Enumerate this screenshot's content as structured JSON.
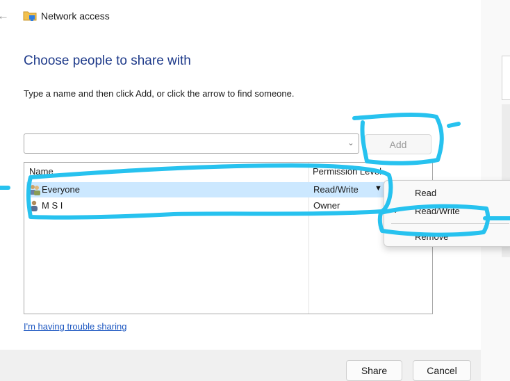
{
  "window": {
    "title": "Network access",
    "back_icon": "back-arrow-icon",
    "title_icon": "network-folder-icon"
  },
  "main": {
    "heading": "Choose people to share with",
    "instruction": "Type a name and then click Add, or click the arrow to find someone.",
    "name_input": {
      "value": ""
    },
    "add_label": "Add"
  },
  "list": {
    "columns": [
      "Name",
      "Permission Level"
    ],
    "rows": [
      {
        "name": "Everyone",
        "permission": "Read/Write",
        "icon": "group-users-icon",
        "selected": true
      },
      {
        "name": "M S I",
        "permission": "Owner",
        "icon": "user-icon",
        "selected": false
      }
    ]
  },
  "help_link": "I'm having trouble sharing",
  "footer": {
    "share_label": "Share",
    "cancel_label": "Cancel"
  },
  "context_menu": {
    "items": [
      "Read",
      "Read/Write",
      "Remove"
    ],
    "checked": "Read/Write"
  },
  "colors": {
    "heading": "#1e3a8a",
    "link": "#1a55c0",
    "selection": "#cce8ff",
    "annotation": "#27c2ef"
  }
}
